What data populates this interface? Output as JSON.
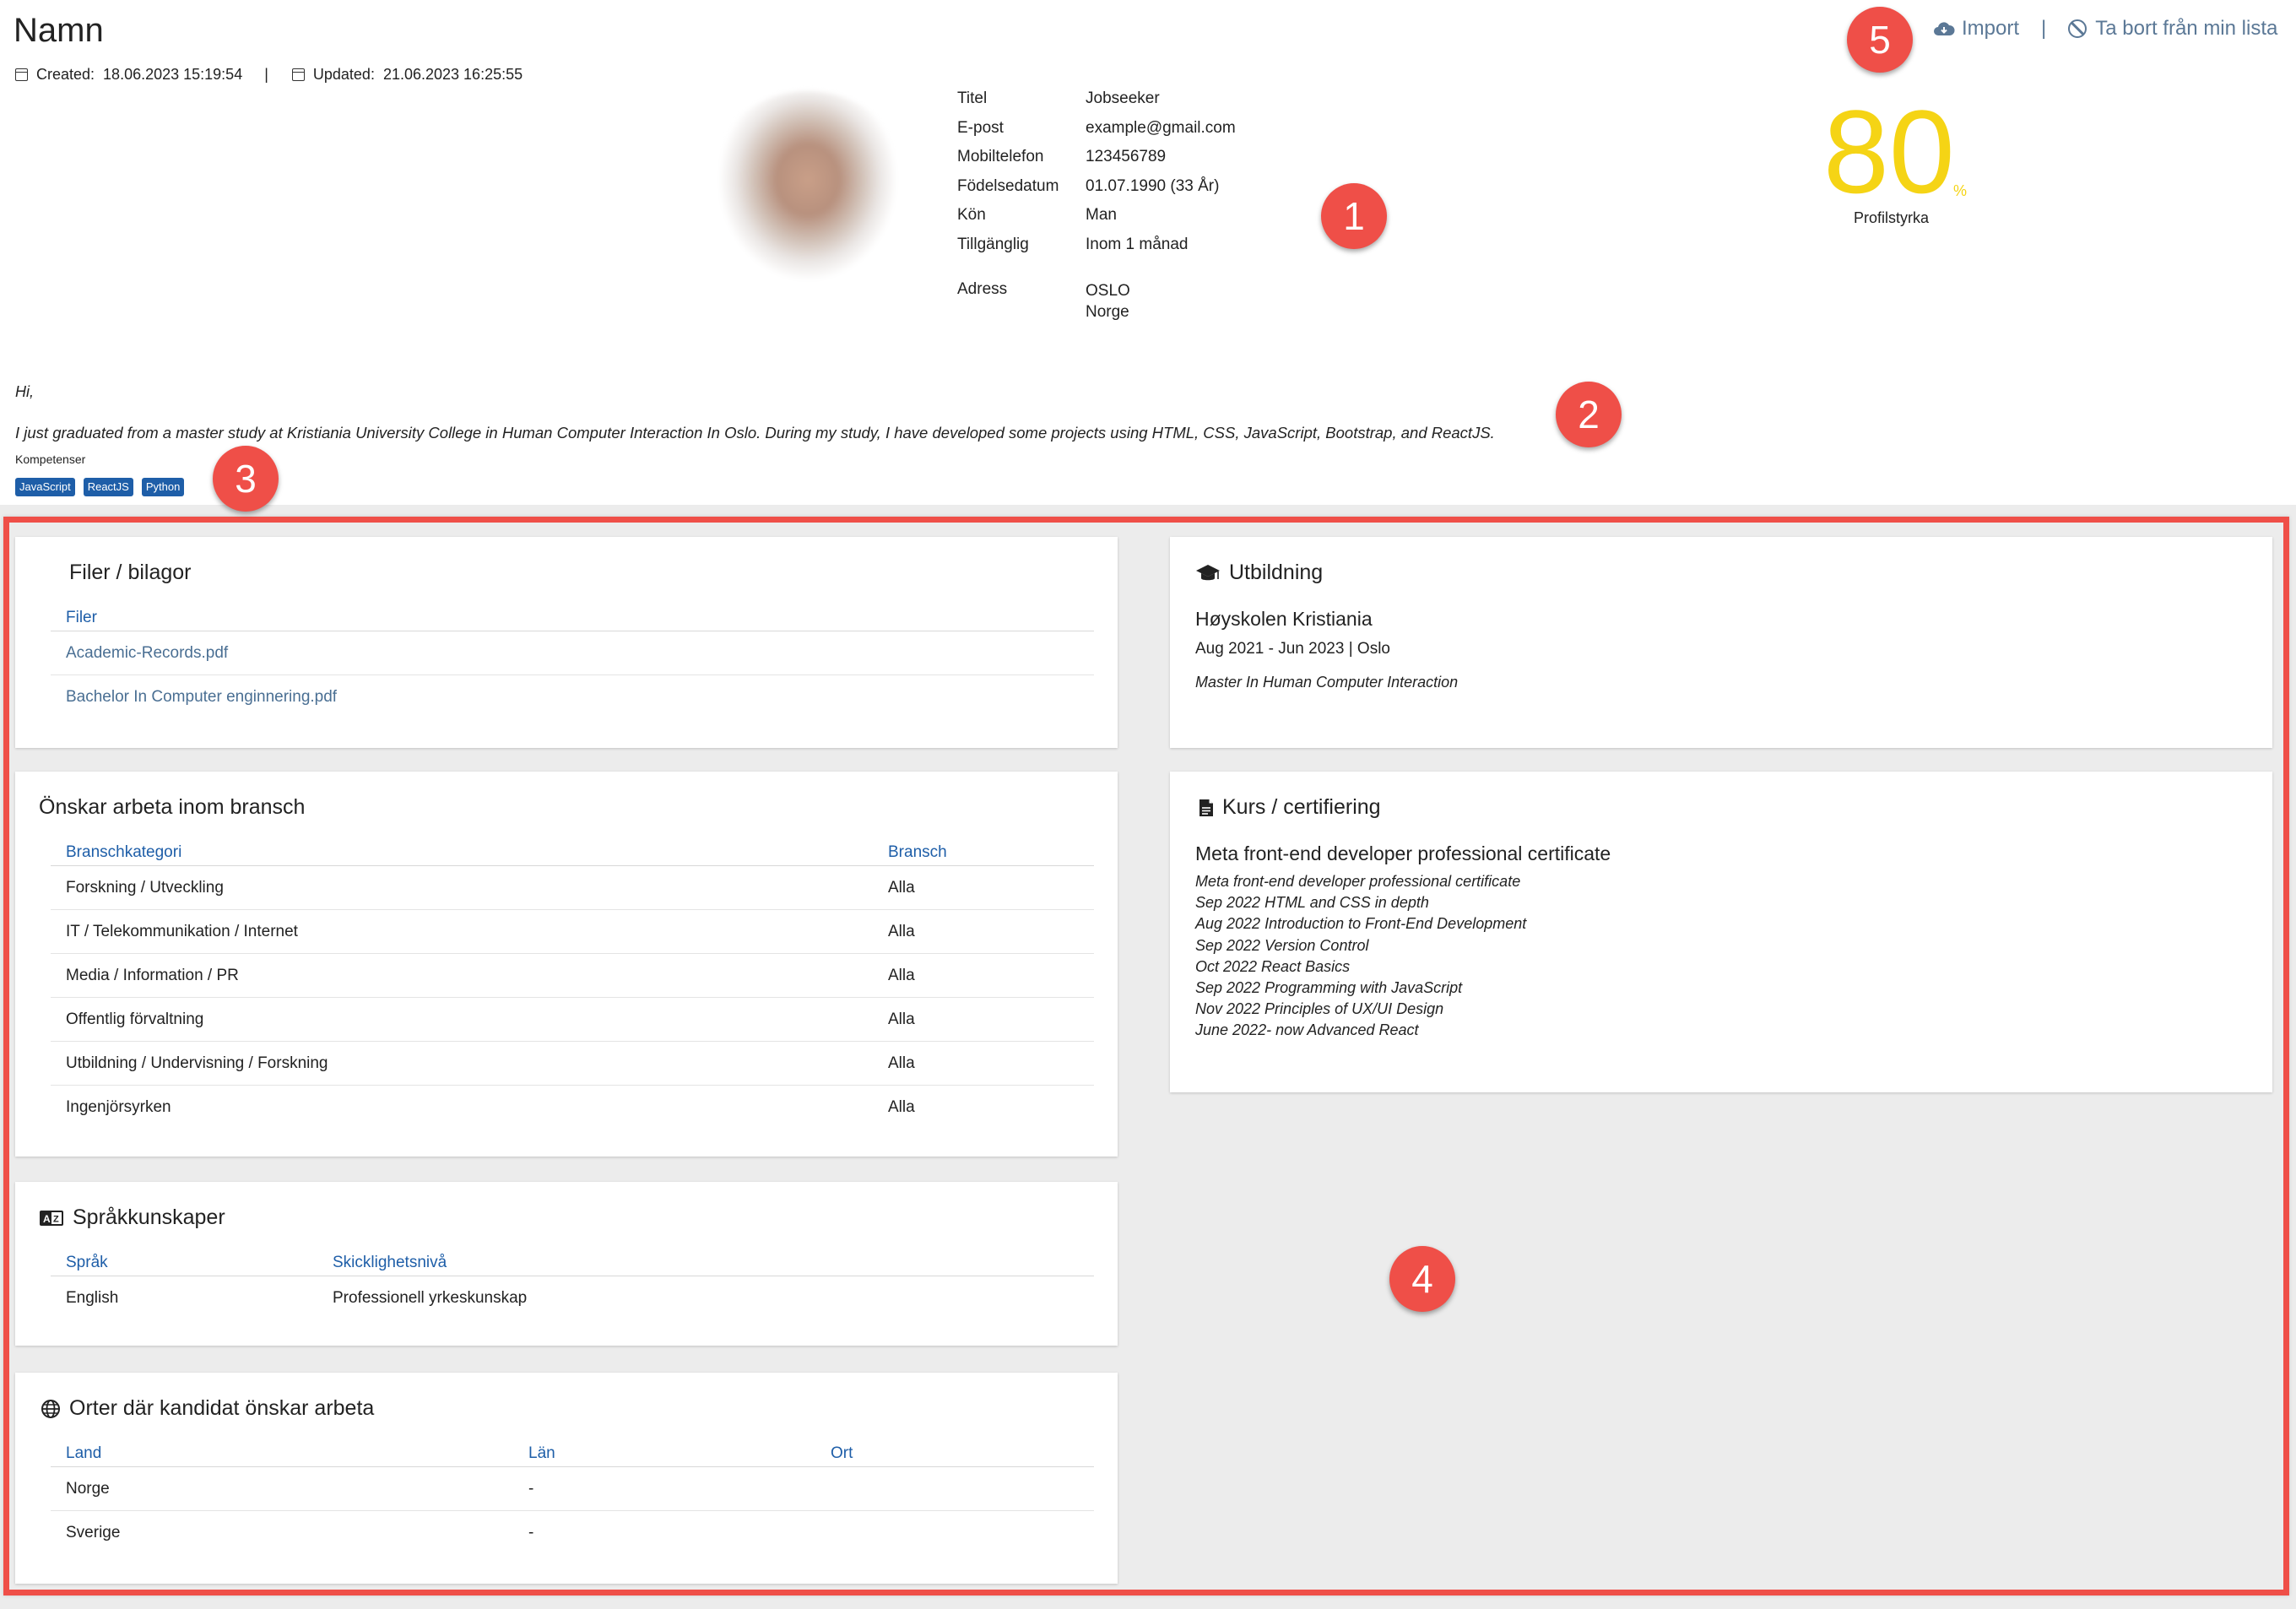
{
  "header": {
    "title": "Namn",
    "created_label": "Created:",
    "created_value": "18.06.2023 15:19:54",
    "separator": "|",
    "updated_label": "Updated:",
    "updated_value": "21.06.2023 16:25:55"
  },
  "actions": {
    "import_label": "Import",
    "separator": "|",
    "remove_label": "Ta bort från min lista",
    "import_icon": "cloud-download-icon",
    "remove_icon": "ban-icon"
  },
  "profile": {
    "fields": [
      {
        "label": "Titel",
        "value": "Jobseeker"
      },
      {
        "label": "E-post",
        "value": "example@gmail.com"
      },
      {
        "label": "Mobiltelefon",
        "value": "123456789"
      },
      {
        "label": "Födelsedatum",
        "value": "01.07.1990 (33 År)"
      },
      {
        "label": "Kön",
        "value": "Man"
      },
      {
        "label": "Tillgänglig",
        "value": "Inom 1 månad"
      }
    ],
    "address_label": "Adress",
    "address_lines": [
      "OSLO",
      "Norge"
    ]
  },
  "strength": {
    "value": "80",
    "unit": "%",
    "label": "Profilstyrka",
    "color": "#f5d415"
  },
  "bio": {
    "greeting": "Hi,",
    "text": "I just graduated from a master study at Kristiania University College in Human Computer Interaction In Oslo. During my study, I have developed some projects using HTML, CSS, JavaScript, Bootstrap, and ReactJS."
  },
  "skills": {
    "label": "Kompetenser",
    "items": [
      "JavaScript",
      "ReactJS",
      "Python"
    ]
  },
  "markers": [
    "1",
    "2",
    "3",
    "4",
    "5"
  ],
  "files": {
    "title": "Filer / bilagor",
    "header": "Filer",
    "items": [
      "Academic-Records.pdf",
      "Bachelor In Computer enginnering.pdf"
    ]
  },
  "industry": {
    "title": "Önskar arbeta inom bransch",
    "headers": [
      "Branschkategori",
      "Bransch"
    ],
    "rows": [
      [
        "Forskning / Utveckling",
        "Alla"
      ],
      [
        "IT / Telekommunikation / Internet",
        "Alla"
      ],
      [
        "Media / Information / PR",
        "Alla"
      ],
      [
        "Offentlig förvaltning",
        "Alla"
      ],
      [
        "Utbildning / Undervisning / Forskning",
        "Alla"
      ],
      [
        "Ingenjörsyrken",
        "Alla"
      ]
    ]
  },
  "languages": {
    "title": "Språkkunskaper",
    "icon": "language-icon",
    "headers": [
      "Språk",
      "Skicklighetsnivå"
    ],
    "rows": [
      [
        "English",
        "Professionell yrkeskunskap"
      ]
    ]
  },
  "locations": {
    "title": "Orter där kandidat önskar arbeta",
    "icon": "globe-icon",
    "headers": [
      "Land",
      "Län",
      "Ort"
    ],
    "rows": [
      [
        "Norge",
        "-",
        ""
      ],
      [
        "Sverige",
        "-",
        ""
      ]
    ]
  },
  "education": {
    "title": "Utbildning",
    "icon": "graduation-cap-icon",
    "school": "Høyskolen Kristiania",
    "period": "Aug 2021 - Jun 2023 | Oslo",
    "degree": "Master In Human Computer Interaction"
  },
  "courses": {
    "title": "Kurs / certifiering",
    "icon": "document-icon",
    "heading": "Meta front-end developer professional certificate",
    "items": [
      "Meta front-end developer professional certificate",
      "Sep 2022 HTML and CSS in depth",
      "Aug 2022 Introduction to Front-End Development",
      "Sep 2022 Version Control",
      "Oct 2022 React Basics",
      "Sep 2022 Programming with JavaScript",
      "Nov 2022 Principles of UX/UI Design",
      "June 2022- now Advanced React"
    ]
  }
}
